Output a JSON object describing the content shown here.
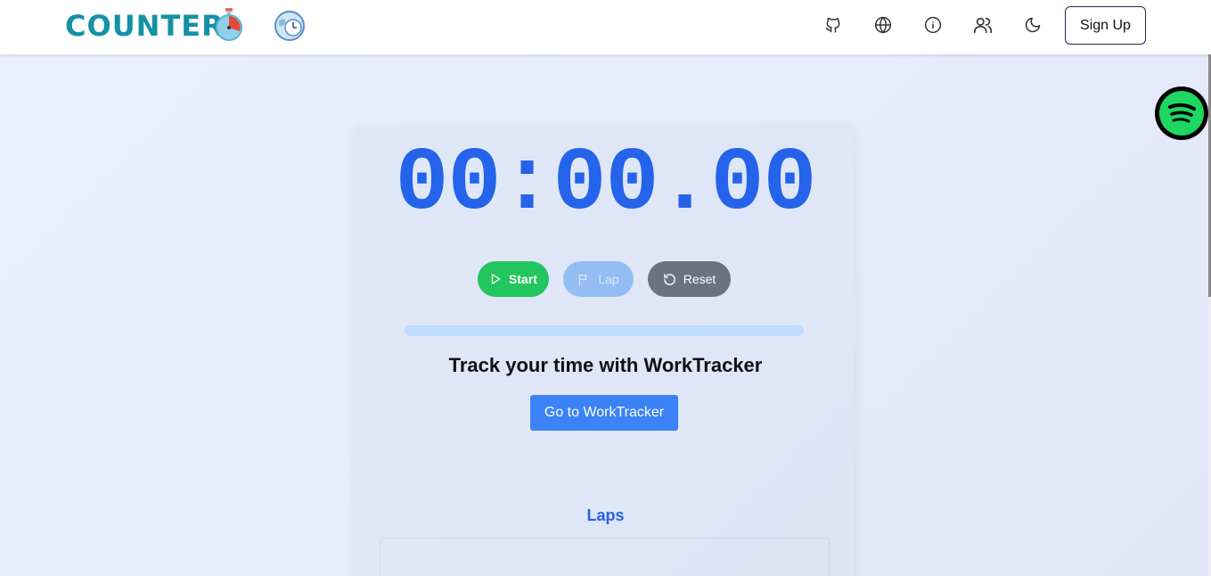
{
  "header": {
    "logo_text": "COUNTER",
    "nav_icons": [
      "github-icon",
      "globe-icon",
      "info-icon",
      "users-icon",
      "moon-icon"
    ],
    "signup_label": "Sign Up"
  },
  "timer": {
    "display": "00:00.00"
  },
  "controls": {
    "start_label": "Start",
    "lap_label": "Lap",
    "reset_label": "Reset"
  },
  "progress": {
    "value": 0
  },
  "worktracker": {
    "heading": "Track your time with WorkTracker",
    "button_label": "Go to WorkTracker"
  },
  "laps": {
    "heading": "Laps",
    "items": []
  },
  "colors": {
    "accent": "#2563eb",
    "start": "#22c55e",
    "lap": "#93bdf3",
    "reset": "#6b7280",
    "logo": "#1591a6",
    "spotify": "#1ed760"
  }
}
